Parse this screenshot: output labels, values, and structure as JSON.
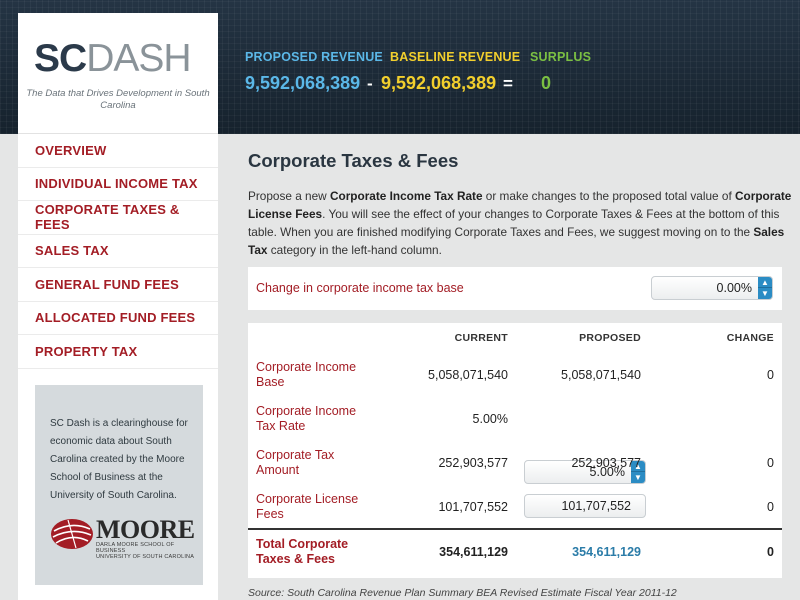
{
  "header": {
    "proposed_label": "PROPOSED REVENUE",
    "baseline_label": "BASELINE REVENUE",
    "surplus_label": "SURPLUS",
    "proposed_value": "9,592,068,389",
    "minus": "-",
    "baseline_value": "9,592,068,389",
    "equals": "=",
    "surplus_value": "0",
    "colors": {
      "proposed": "#5bb8e8",
      "baseline": "#f2cf2d",
      "surplus": "#7bc043"
    }
  },
  "sidebar": {
    "logo_sc": "SC",
    "logo_dash": "DASH",
    "tagline": "The Data that Drives Development in South Carolina",
    "nav": [
      {
        "label": "OVERVIEW"
      },
      {
        "label": "INDIVIDUAL INCOME TAX"
      },
      {
        "label": "CORPORATE TAXES & FEES"
      },
      {
        "label": "SALES TAX"
      },
      {
        "label": "GENERAL FUND FEES"
      },
      {
        "label": "ALLOCATED FUND FEES"
      },
      {
        "label": "PROPERTY TAX"
      }
    ],
    "info_text": "SC Dash is a clearinghouse for economic data about South Carolina created by the Moore School of Business at the University of South Carolina.",
    "moore_word": "MOORE",
    "moore_sub1": "DARLA MOORE SCHOOL OF BUSINESS",
    "moore_sub2": "UNIVERSITY OF SOUTH CAROLINA"
  },
  "main": {
    "title": "Corporate Taxes & Fees",
    "intro": {
      "p1": "Propose a new ",
      "b1": "Corporate Income Tax Rate",
      "p2": " or make changes to the proposed total value of ",
      "b2": "Corporate License Fees",
      "p3": ". You will see the effect of your changes to Corporate Taxes & Fees at the bottom of this table. When you are finished modifying Corporate Taxes and Fees, we suggest moving on to the ",
      "b3": "Sales Tax",
      "p4": " category in the left-hand column."
    },
    "base_change": {
      "label": "Change in corporate income tax base",
      "value": "0.00%"
    },
    "table": {
      "headers": {
        "current": "CURRENT",
        "proposed": "PROPOSED",
        "change": "CHANGE"
      },
      "rows": [
        {
          "name": "Corporate Income Base",
          "current": "5,058,071,540",
          "proposed": "5,058,071,540",
          "change": "0"
        },
        {
          "name": "Corporate Income Tax Rate",
          "current": "5.00%",
          "proposed": "5.00%",
          "change": ""
        },
        {
          "name": "Corporate Tax Amount",
          "current": "252,903,577",
          "proposed": "252,903,577",
          "change": "0"
        },
        {
          "name": "Corporate License Fees",
          "current": "101,707,552",
          "proposed": "101,707,552",
          "change": "0"
        }
      ],
      "total": {
        "name": "Total Corporate Taxes & Fees",
        "current": "354,611,129",
        "proposed": "354,611,129",
        "change": "0"
      }
    },
    "source": "Source: South Carolina Revenue Plan Summary BEA Revised Estimate Fiscal Year 2011-12"
  }
}
